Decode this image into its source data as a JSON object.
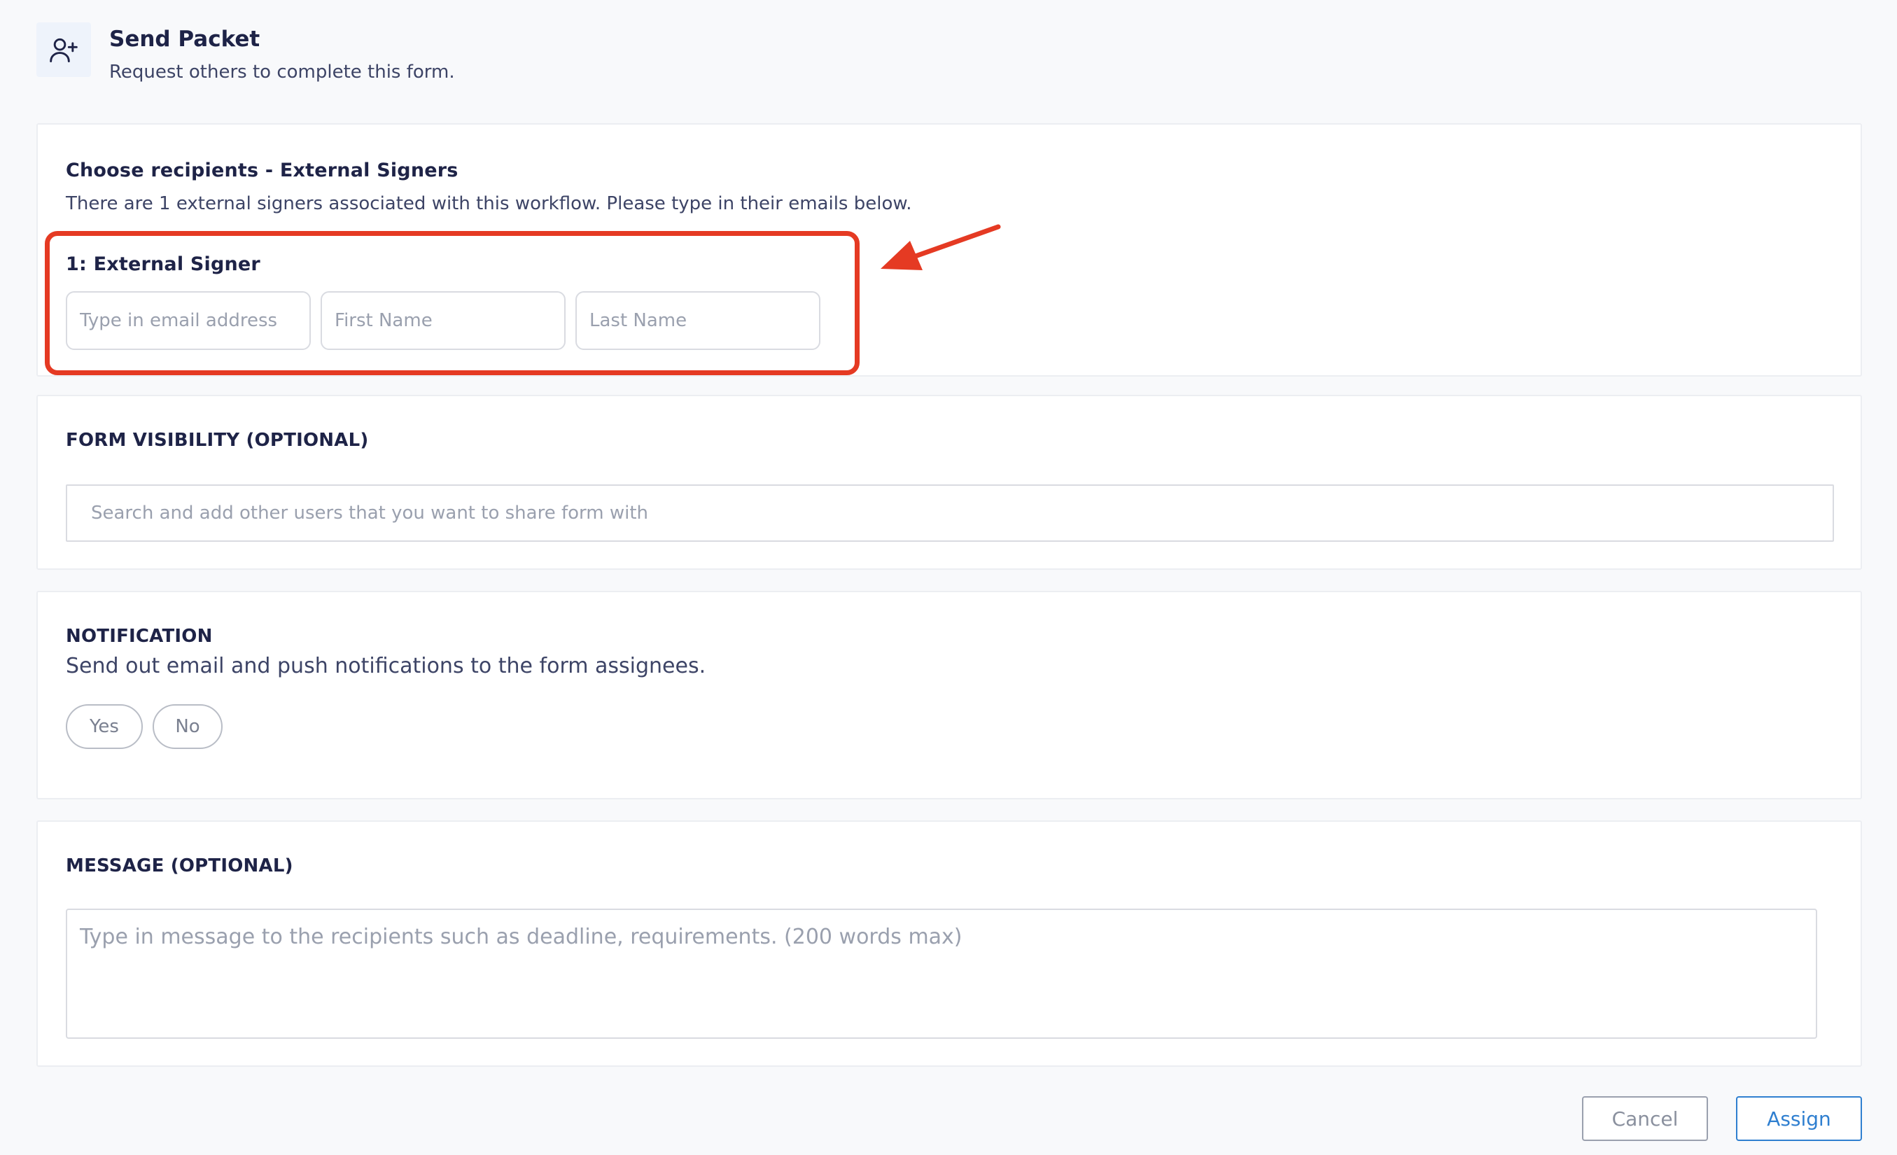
{
  "header": {
    "icon": "user-plus-icon",
    "title": "Send Packet",
    "subtitle": "Request others to complete this form."
  },
  "recipients": {
    "title": "Choose recipients - External Signers",
    "description": "There are 1 external signers associated with this workflow. Please type in their emails below.",
    "signer_label": "1: External Signer",
    "email_placeholder": "Type in email address",
    "first_name_placeholder": "First Name",
    "last_name_placeholder": "Last Name"
  },
  "visibility": {
    "title": "FORM VISIBILITY (OPTIONAL)",
    "search_placeholder": "Search and add other users that you want to share form with"
  },
  "notification": {
    "title": "NOTIFICATION",
    "description": "Send out email and push notifications to the form assignees.",
    "yes_label": "Yes",
    "no_label": "No"
  },
  "message": {
    "title": "MESSAGE (OPTIONAL)",
    "placeholder": "Type in message to the recipients such as deadline, requirements. (200 words max)"
  },
  "footer": {
    "cancel_label": "Cancel",
    "assign_label": "Assign"
  },
  "colors": {
    "annotation": "#e53a23",
    "primary": "#2f7fd0"
  }
}
